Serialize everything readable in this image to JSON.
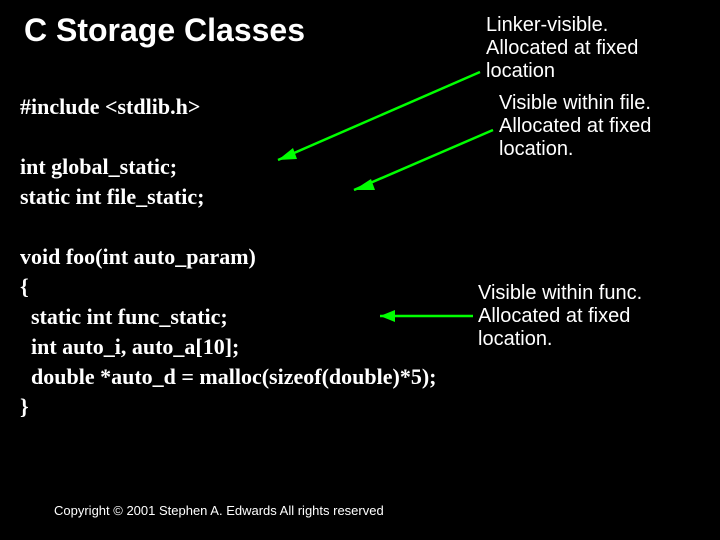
{
  "title": "C Storage Classes",
  "code": {
    "include": "#include <stdlib.h>",
    "global": "int global_static;",
    "filestatic": "static int file_static;",
    "funcsig": "void foo(int auto_param)",
    "lbrace": "{",
    "funcstatic": "  static int func_static;",
    "autos": "  int auto_i, auto_a[10];",
    "malloc": "  double *auto_d = malloc(sizeof(double)*5);",
    "rbrace": "}"
  },
  "notes": {
    "n1a": "Linker-visible.",
    "n1b": "Allocated at fixed",
    "n1c": "location",
    "n2a": "Visible within file.",
    "n2b": "Allocated at fixed",
    "n2c": "location.",
    "n3a": "Visible within func.",
    "n3b": "Allocated at fixed",
    "n3c": "location."
  },
  "footer": "Copyright © 2001 Stephen A. Edwards  All rights reserved"
}
